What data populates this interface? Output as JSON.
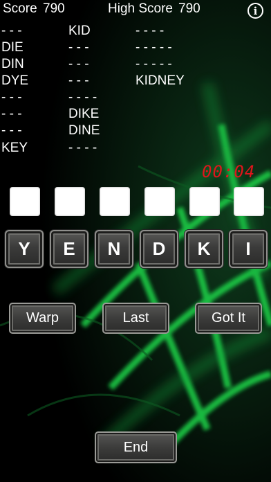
{
  "header": {
    "score_label": "Score",
    "score_value": "790",
    "high_score_label": "High Score",
    "high_score_value": "790",
    "info_icon": "i"
  },
  "words": {
    "col1": [
      "- - -",
      "DIE",
      "DIN",
      "DYE",
      "- - -",
      "- - -",
      "- - -",
      "KEY"
    ],
    "col2": [
      "KID",
      "- - -",
      "- - -",
      "- - -",
      "- - - -",
      "DIKE",
      "DINE",
      "- - - -"
    ],
    "col3": [
      "- - - -",
      "- - - - -",
      "- - - - -",
      "KIDNEY"
    ]
  },
  "timer": "00:04",
  "answer_slots": 6,
  "tiles": [
    "Y",
    "E",
    "N",
    "D",
    "K",
    "I"
  ],
  "buttons": {
    "warp": "Warp",
    "last": "Last",
    "got_it": "Got It",
    "end": "End"
  },
  "colors": {
    "timer": "#e0151c",
    "background": "#000000",
    "glow": "#1fd64a"
  }
}
